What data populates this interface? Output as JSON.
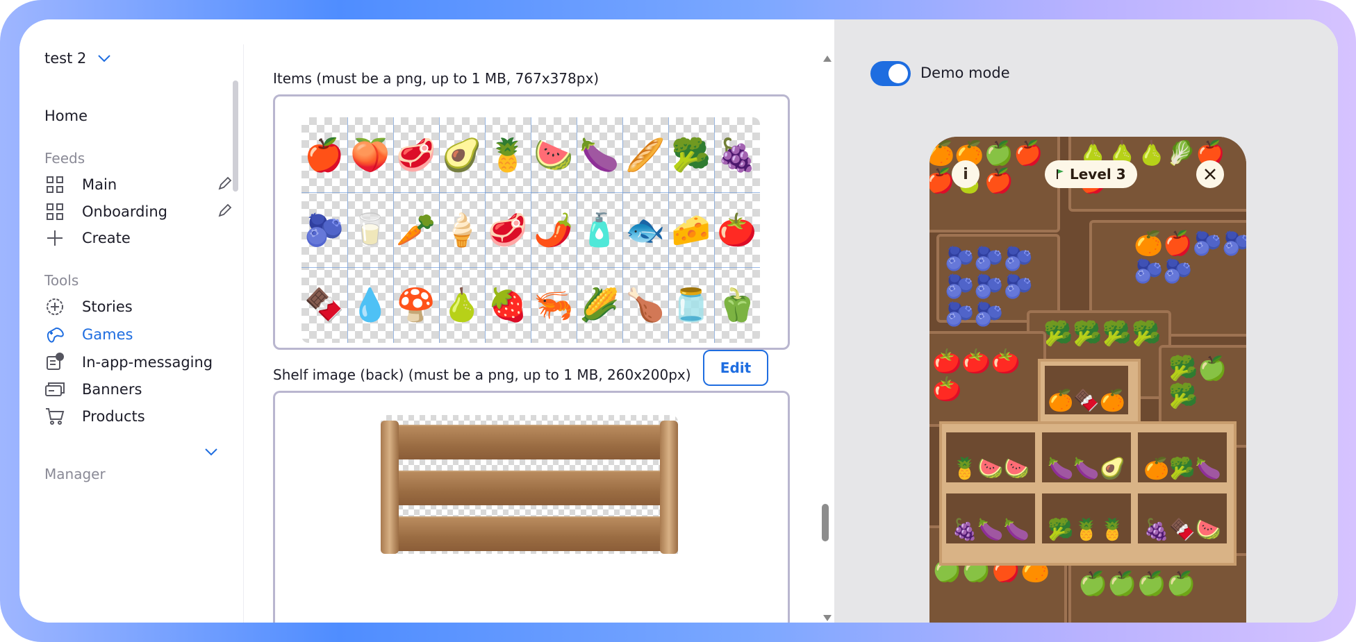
{
  "sidebar": {
    "workspace": "test 2",
    "home": "Home",
    "feeds_title": "Feeds",
    "feeds": [
      {
        "label": "Main"
      },
      {
        "label": "Onboarding"
      }
    ],
    "create": "Create",
    "tools_title": "Tools",
    "tools": [
      {
        "label": "Stories",
        "icon": "plus-circle-icon"
      },
      {
        "label": "Games",
        "icon": "gamepad-icon",
        "active": true
      },
      {
        "label": "In-app-messaging",
        "icon": "message-icon"
      },
      {
        "label": "Banners",
        "icon": "banner-icon"
      },
      {
        "label": "Products",
        "icon": "cart-icon"
      }
    ],
    "manager_title": "Manager"
  },
  "main": {
    "items_label": "Items (must be a png, up to 1 MB, 767x378px)",
    "edit_label": "Edit",
    "shelf_label": "Shelf image (back) (must be a png, up to 1 MB, 260x200px)",
    "items": [
      [
        "🍎",
        "🍑",
        "🥩",
        "🥑",
        "🍍",
        "🍉",
        "🍆",
        "🥖",
        "🥦",
        "🍇"
      ],
      [
        "🫐",
        "🥛",
        "🥕",
        "🍦",
        "🥩",
        "🌶️",
        "🧴",
        "🐟",
        "🧀",
        "🍅"
      ],
      [
        "🍫",
        "💧",
        "🍄",
        "🍐",
        "🍓",
        "🦐",
        "🌽",
        "🍗",
        "🫙",
        "🫑"
      ]
    ]
  },
  "preview": {
    "demo_mode_label": "Demo mode",
    "demo_mode_on": true,
    "level_label": "Level 3",
    "accent": "#1e6de0"
  }
}
